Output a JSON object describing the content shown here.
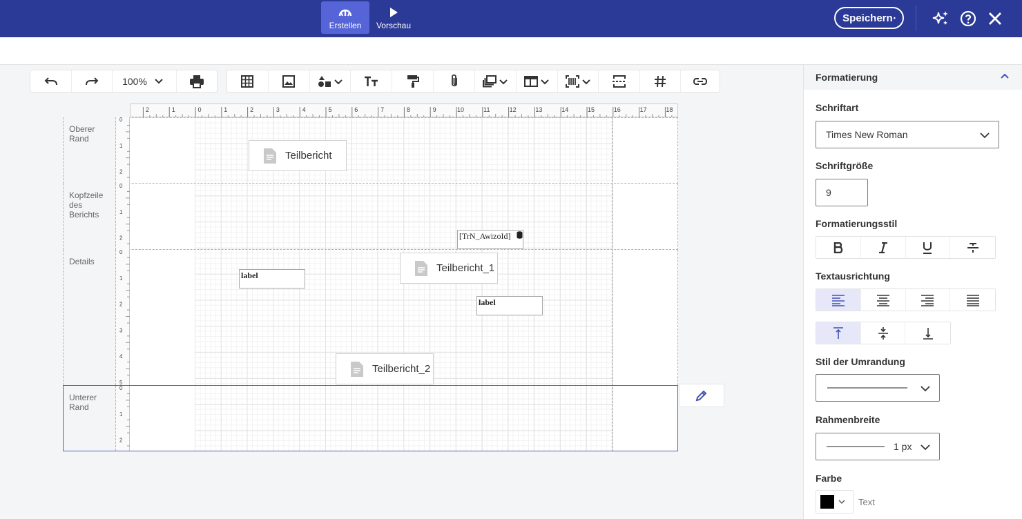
{
  "topbar": {
    "mode_create": "Erstellen",
    "mode_preview": "Vorschau",
    "save": "Speichern",
    "save_dot": "•"
  },
  "toolbar": {
    "zoom": "100%"
  },
  "ruler_h": {
    "ticks": [
      "2",
      "1",
      "0",
      "1",
      "2",
      "3",
      "4",
      "5",
      "6",
      "7",
      "8",
      "9",
      "10",
      "11",
      "12",
      "13",
      "14",
      "15",
      "16",
      "17",
      "18"
    ]
  },
  "bands": [
    {
      "label": "Oberer Rand",
      "ruler": [
        "0",
        "1",
        "2"
      ]
    },
    {
      "label": "Kopfzeile des Berichts",
      "ruler": [
        "0",
        "1",
        "2"
      ]
    },
    {
      "label": "Details",
      "ruler": [
        "0",
        "1",
        "2",
        "3",
        "4",
        "5"
      ]
    },
    {
      "label": "Unterer Rand",
      "ruler": [
        "0",
        "1",
        "2"
      ]
    }
  ],
  "elements": {
    "subreport_1": "Teilbericht",
    "subreport_2": "Teilbericht_1",
    "subreport_3": "Teilbericht_2",
    "field": "[TrN_AwizoId]",
    "label_1": "label",
    "label_2": "label"
  },
  "panel": {
    "section": "Formatierung",
    "font_family_label": "Schriftart",
    "font_family": "Times New Roman",
    "font_size_label": "Schriftgröße",
    "font_size": "9",
    "format_style_label": "Formatierungsstil",
    "text_align_label": "Textausrichtung",
    "border_style_label": "Stil der Umrandung",
    "border_width_label": "Rahmenbreite",
    "border_width": "1 px",
    "color_label": "Farbe",
    "color_target": "Text",
    "color_value": "#000000"
  },
  "colors": {
    "topbar": "#2b3a96",
    "accent": "#5564d6",
    "selected": "#e6e8fa"
  }
}
